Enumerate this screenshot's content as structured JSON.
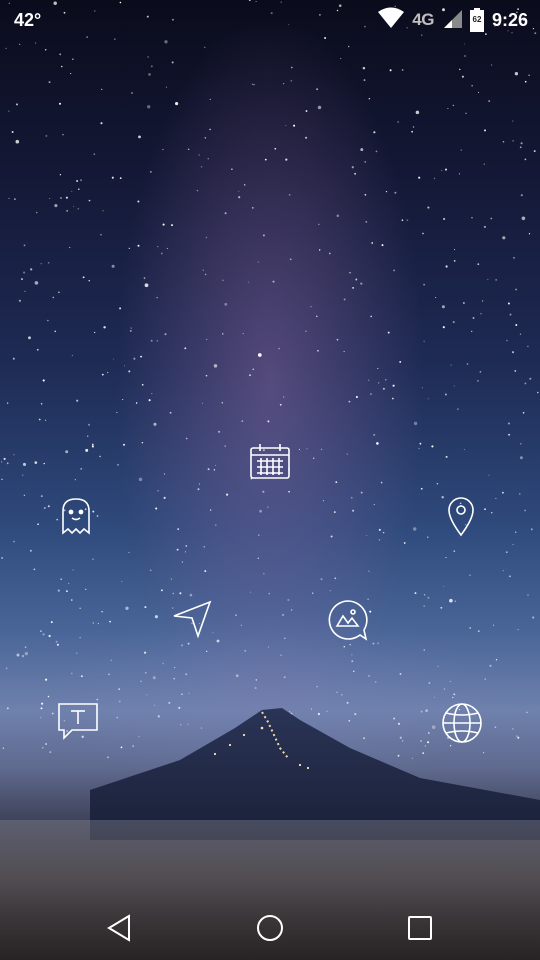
{
  "status_bar": {
    "temperature": "42°",
    "network": "4G",
    "battery_level": "62",
    "time": "9:26",
    "icons": [
      "wifi-icon",
      "signal-icon",
      "battery-icon"
    ]
  },
  "home_icons": [
    {
      "name": "calendar-icon"
    },
    {
      "name": "ghost-icon"
    },
    {
      "name": "location-pin-icon"
    },
    {
      "name": "send-arrow-icon"
    },
    {
      "name": "image-message-icon"
    },
    {
      "name": "text-message-icon"
    },
    {
      "name": "globe-icon"
    }
  ],
  "nav_bar": {
    "icons": [
      "back-triangle-icon",
      "home-circle-icon",
      "recents-square-icon"
    ]
  },
  "colors": {
    "icon_stroke": "#ffffff"
  }
}
